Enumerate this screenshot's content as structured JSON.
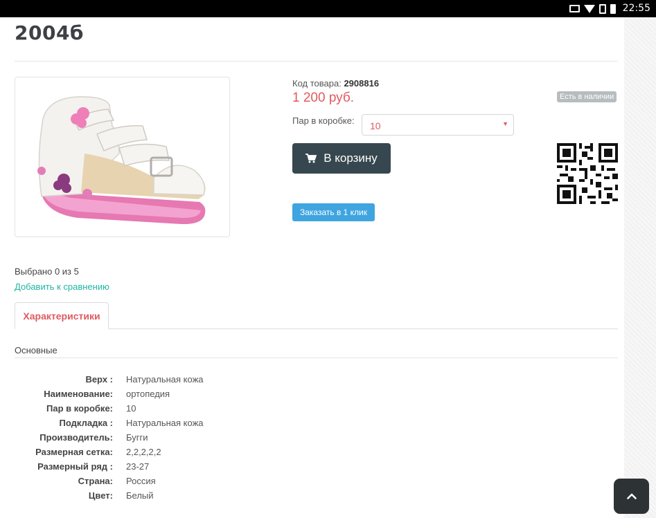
{
  "status_bar": {
    "time": "22:55",
    "icons": [
      "cast-icon",
      "wifi-icon",
      "signal-icon",
      "battery-icon"
    ]
  },
  "product": {
    "title": "2004б",
    "sku_label": "Код товара:",
    "sku_value": "2908816",
    "price": "1 200 руб.",
    "stock_badge": "Есть в наличии",
    "qty_label": "Пар в коробке:",
    "qty_value": "10",
    "add_to_cart": "В корзину",
    "one_click": "Заказать в 1 клик"
  },
  "compare": {
    "count_text": "Выбрано 0 из 5",
    "link_text": "Добавить к сравнению"
  },
  "tabs": [
    {
      "label": "Характеристики",
      "active": true
    }
  ],
  "specs": {
    "section_title": "Основные",
    "rows": [
      {
        "key": "Верх :",
        "value": "Натуральная кожа"
      },
      {
        "key": "Наименование:",
        "value": "ортопедия"
      },
      {
        "key": "Пар в коробке:",
        "value": "10"
      },
      {
        "key": "Подкладка :",
        "value": "Натуральная кожа"
      },
      {
        "key": "Производитель:",
        "value": "Бугги"
      },
      {
        "key": "Размерная сетка:",
        "value": "2,2,2,2,2"
      },
      {
        "key": "Размерный ряд :",
        "value": "23-27"
      },
      {
        "key": "Страна:",
        "value": "Россия"
      },
      {
        "key": "Цвет:",
        "value": "Белый"
      }
    ]
  },
  "colors": {
    "accent_price": "#e05a5f",
    "cart_button": "#37474f",
    "one_click_button": "#3fa5e0",
    "compare_link": "#1fb5a2",
    "stock_badge": "#b7bcbf"
  }
}
